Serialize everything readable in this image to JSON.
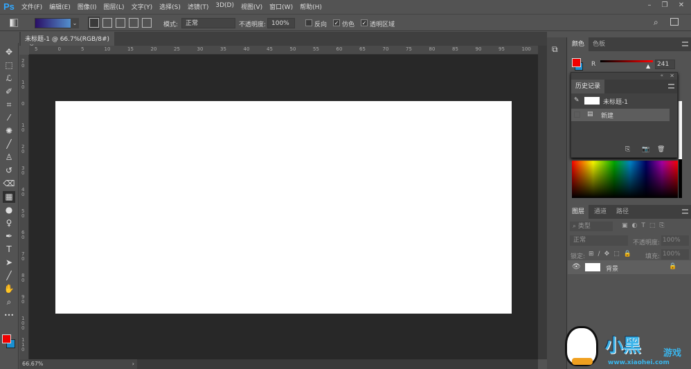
{
  "app": {
    "logo": "Ps"
  },
  "menu": [
    "文件(F)",
    "编辑(E)",
    "图像(I)",
    "图层(L)",
    "文字(Y)",
    "选择(S)",
    "滤镜(T)",
    "3D(D)",
    "视图(V)",
    "窗口(W)",
    "帮助(H)"
  ],
  "options": {
    "mode_label": "模式:",
    "mode_value": "正常",
    "opacity_label": "不透明度:",
    "opacity_value": "100%",
    "reverse": "反向",
    "reverse_checked": false,
    "dither": "仿色",
    "dither_checked": true,
    "transparency": "透明区域",
    "transparency_checked": true,
    "gradient_colors": [
      "#2a0f66",
      "#5aa6e0"
    ]
  },
  "document": {
    "tab": "未标题-1 @ 66.7%(RGB/8#)",
    "close": "×",
    "zoom": "66.67%"
  },
  "rulers": {
    "h": [
      "5",
      "0",
      "5",
      "10",
      "15",
      "20",
      "25",
      "30",
      "35",
      "40",
      "45",
      "50",
      "55",
      "60",
      "65",
      "70",
      "75",
      "80",
      "85",
      "90",
      "95",
      "100"
    ],
    "v": [
      "2 0",
      "1 0",
      "0",
      "1 0",
      "2 0",
      "3 0",
      "4 0",
      "5 0",
      "6 0",
      "7 0",
      "8 0",
      "9 0",
      "1 0 0",
      "1 1 0"
    ]
  },
  "tools": [
    "move-icon",
    "marquee-icon",
    "lasso-icon",
    "quick-select-icon",
    "crop-icon",
    "eyedropper-icon",
    "healing-icon",
    "brush-icon",
    "stamp-icon",
    "history-brush-icon",
    "eraser-icon",
    "gradient-icon",
    "blur-icon",
    "dodge-icon",
    "pen-icon",
    "type-icon",
    "path-select-icon",
    "line-icon",
    "hand-icon",
    "zoom-icon",
    "more-icon"
  ],
  "colors": {
    "foreground": "#f00000",
    "background": "#1a8fd0"
  },
  "color_panel": {
    "tabs": [
      "颜色",
      "色板"
    ],
    "channel": "R",
    "value": "241"
  },
  "history": {
    "tab": "历史记录",
    "items": [
      {
        "label": "未标题-1"
      },
      {
        "label": "新建"
      }
    ]
  },
  "layers": {
    "tabs": [
      "图层",
      "通道",
      "路径"
    ],
    "filter": "类型",
    "blend": "正常",
    "opacity_label": "不透明度:",
    "opacity": "100%",
    "lock_label": "锁定:",
    "fill_label": "填充:",
    "fill": "100%",
    "layer_name": "背景"
  },
  "watermark": {
    "text": "小黑游戏",
    "url": "www.xiaohei.com"
  }
}
